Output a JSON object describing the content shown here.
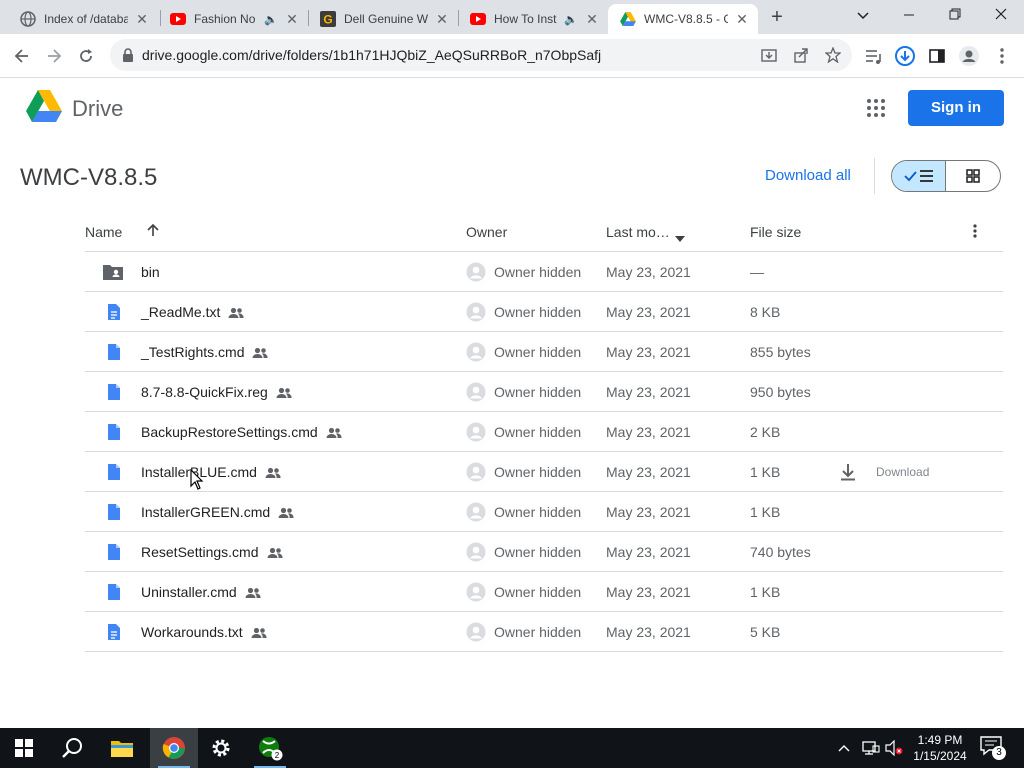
{
  "browser": {
    "tabs": [
      {
        "title": "Index of /databa",
        "icon": "globe-icon",
        "audio": false
      },
      {
        "title": "Fashion No",
        "icon": "youtube-icon",
        "audio": true
      },
      {
        "title": "Dell Genuine W",
        "icon": "g-icon",
        "audio": false
      },
      {
        "title": "How To Inst",
        "icon": "youtube-icon",
        "audio": true
      },
      {
        "title": "WMC-V8.8.5 - G",
        "icon": "drive-icon",
        "audio": false,
        "active": true
      }
    ],
    "new_tab_label": "+",
    "url": "drive.google.com/drive/folders/1b1h71HJQbiZ_AeQSuRRBoR_n7ObpSafj"
  },
  "drive": {
    "app_name": "Drive",
    "sign_in_label": "Sign in",
    "folder_title": "WMC-V8.8.5",
    "download_all_label": "Download all",
    "columns": {
      "name": "Name",
      "owner": "Owner",
      "last_modified": "Last mo…",
      "file_size": "File size"
    },
    "files": [
      {
        "name": "bin",
        "type": "folder",
        "shared": false,
        "owner": "Owner hidden",
        "modified": "May 23, 2021",
        "size": "—"
      },
      {
        "name": "_ReadMe.txt",
        "type": "doc",
        "shared": true,
        "owner": "Owner hidden",
        "modified": "May 23, 2021",
        "size": "8 KB"
      },
      {
        "name": "_TestRights.cmd",
        "type": "file",
        "shared": true,
        "owner": "Owner hidden",
        "modified": "May 23, 2021",
        "size": "855 bytes"
      },
      {
        "name": "8.7-8.8-QuickFix.reg",
        "type": "file",
        "shared": true,
        "owner": "Owner hidden",
        "modified": "May 23, 2021",
        "size": "950 bytes"
      },
      {
        "name": "BackupRestoreSettings.cmd",
        "type": "file",
        "shared": true,
        "owner": "Owner hidden",
        "modified": "May 23, 2021",
        "size": "2 KB"
      },
      {
        "name": "InstallerBLUE.cmd",
        "type": "file",
        "shared": true,
        "owner": "Owner hidden",
        "modified": "May 23, 2021",
        "size": "1 KB",
        "hover_action": "Download"
      },
      {
        "name": "InstallerGREEN.cmd",
        "type": "file",
        "shared": true,
        "owner": "Owner hidden",
        "modified": "May 23, 2021",
        "size": "1 KB"
      },
      {
        "name": "ResetSettings.cmd",
        "type": "file",
        "shared": true,
        "owner": "Owner hidden",
        "modified": "May 23, 2021",
        "size": "740 bytes"
      },
      {
        "name": "Uninstaller.cmd",
        "type": "file",
        "shared": true,
        "owner": "Owner hidden",
        "modified": "May 23, 2021",
        "size": "1 KB"
      },
      {
        "name": "Workarounds.txt",
        "type": "doc",
        "shared": true,
        "owner": "Owner hidden",
        "modified": "May 23, 2021",
        "size": "5 KB"
      }
    ]
  },
  "taskbar": {
    "time": "1:49 PM",
    "date": "1/15/2024",
    "xbox_badge": "2",
    "notification_count": "3"
  },
  "colors": {
    "accent": "#1a73e8",
    "file_icon": "#4285f4",
    "folder_icon": "#5f6368",
    "taskbar": "#101418"
  }
}
